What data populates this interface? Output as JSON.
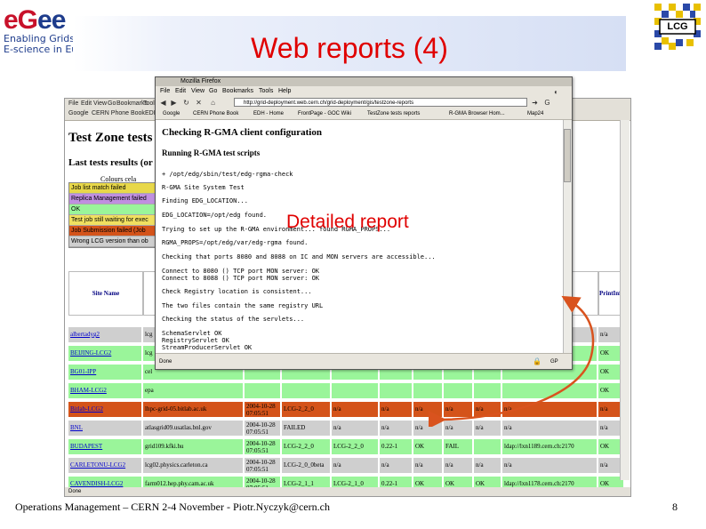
{
  "slide": {
    "title": "Web reports (4)",
    "footer": "Operations Management – CERN 2-4 November - Piotr.Nyczyk@cern.ch",
    "page_number": "8",
    "annotation": "Detailed report",
    "logos": {
      "egee_word_a": "eG",
      "egee_word_b": "ee",
      "egee_line1": "Enabling Grids f",
      "egee_line2": "E-science in Euro",
      "lcg": "LCG"
    },
    "colors": {
      "title": "#e00000",
      "green_row": "#9af59a",
      "grey_row": "#cfcfcf",
      "failed_row": "#d4531a",
      "arrow": "#d9531e"
    }
  },
  "moz": {
    "window_title": "Mozilla Firefox",
    "menu": [
      "File",
      "Edit",
      "View",
      "Go",
      "Bookmarks",
      "Tools",
      "Help"
    ],
    "url": "http://grid-deployment.web.cern.ch/grid-deployment/gis/testzone-reports",
    "bookmarks": [
      "Google",
      "CERN Phone Book",
      "EDH - Home",
      "FrontPage - GOC Wiki",
      "TestZone tests reports",
      "R-GMA Browser Hom...",
      "Map24"
    ],
    "status": "Done",
    "status_right": "GP",
    "log": {
      "heading1": "Checking R-GMA client configuration",
      "heading2": "Running R-GMA test scripts",
      "lines": [
        "+ /opt/edg/sbin/test/edg-rgma-check",
        "R-GMA Site System Test",
        "Finding EDG_LOCATION...",
        "EDG_LOCATION=/opt/edg found.",
        "Trying to set up the R-GMA environment... found RGMA_PROPS...",
        "RGMA_PROPS=/opt/edg/var/edg-rgma found.",
        "Checking that ports 8080 and 8088 on IC and MON servers are accessible...",
        "Connect to 8080 () TCP port MON server: OK",
        "Connect to 8088 () TCP port MON server: OK",
        "Check Registry location is consistent...",
        "The two files contain the same registry URL",
        "Checking the status of the servlets...",
        "SchemaServlet OK",
        "RegistryServlet OK",
        "StreamProducerServlet OK"
      ]
    }
  },
  "bg": {
    "page_title": "Test Zone tests",
    "subtitle": "Last tests results (or",
    "colours_label": "Colours cela",
    "status": "Done",
    "toolbar_items": [
      "File",
      "Edit",
      "View",
      "Go",
      "Bookmarks",
      "Tools"
    ],
    "bookmark_items": [
      "Google",
      "CERN Phone Book",
      "EDI"
    ],
    "legend": [
      {
        "label": "Job list match failed",
        "color": "#e8d84a"
      },
      {
        "label": "Replica Management failed",
        "color": "#c08fe0"
      },
      {
        "label": "OK",
        "color": "#9af59a"
      },
      {
        "label": "Test job still waiting for exec",
        "color": "#f0e060"
      },
      {
        "label": "Job Submission failed (Job",
        "color": "#d4531a"
      },
      {
        "label": "Wrong LCG version than ob",
        "color": "#cfcfcf"
      }
    ],
    "header": {
      "site": "Site Name",
      "print": "PrintInfo"
    },
    "rows": [
      {
        "site": "albertadyg2",
        "ce": "lcg",
        "date": "",
        "ver": "",
        "c5": "",
        "c6": "",
        "c7": "",
        "c8": "",
        "c9": "",
        "c10": "",
        "last": "n/a",
        "color": "#cfcfcf"
      },
      {
        "site": "BEIJING-LCG2",
        "ce": "lcg",
        "date": "",
        "ver": "",
        "c5": "",
        "c6": "",
        "c7": "",
        "c8": "",
        "c9": "",
        "c10": "",
        "last": "OK",
        "color": "#9af59a"
      },
      {
        "site": "BG01-IPP",
        "ce": "cel",
        "date": "",
        "ver": "",
        "c5": "",
        "c6": "",
        "c7": "",
        "c8": "",
        "c9": "",
        "c10": "",
        "last": "OK",
        "color": "#9af59a"
      },
      {
        "site": "BHAM-LCG2",
        "ce": "epa",
        "date": "",
        "ver": "",
        "c5": "",
        "c6": "",
        "c7": "",
        "c8": "",
        "c9": "",
        "c10": "",
        "last": "OK",
        "color": "#9af59a"
      },
      {
        "site": "Bitlab-LCG2",
        "ce": "lhpc-grid-05.bitlab.ac.uk",
        "date": "2004-10-28 07:05:51",
        "ver": "LCG-2_2_0",
        "c5": "n/a",
        "c6": "n/a",
        "c7": "n/a",
        "c8": "n/a",
        "c9": "n/a",
        "c10": "n/a",
        "last": "n/a",
        "color": "#d4531a"
      },
      {
        "site": "BNL",
        "ce": "atlasgrid09.usatlas.bnl.gov",
        "date": "2004-10-28 07:05:51",
        "ver": "FAILED",
        "c5": "n/a",
        "c6": "n/a",
        "c7": "n/a",
        "c8": "n/a",
        "c9": "n/a",
        "c10": "n/a",
        "last": "n/a",
        "color": "#cfcfcf"
      },
      {
        "site": "BUDAPEST",
        "ce": "grid109.kfki.hu",
        "date": "2004-10-28 07:05:51",
        "ver": "LCG-2_2_0",
        "c5": "LCG-2_2_0",
        "c6": "0.22-1",
        "c7": "OK",
        "c8": "FAIL",
        "c9": "",
        "c10": "ldap://lxn1189.cern.ch:2170",
        "last": "OK",
        "color": "#9af59a"
      },
      {
        "site": "CARLETONU-LCG2",
        "ce": "lcg02.physics.carleton.ca",
        "date": "2004-10-28 07:05:51",
        "ver": "LCG-2_0_0beta",
        "c5": "n/a",
        "c6": "n/a",
        "c7": "n/a",
        "c8": "n/a",
        "c9": "n/a",
        "c10": "n/a",
        "last": "n/a",
        "color": "#cfcfcf"
      },
      {
        "site": "CAVENDISH-LCG2",
        "ce": "farm012.hep.phy.cam.ac.uk",
        "date": "2004-10-28 07:05:51",
        "ver": "LCG-2_1_1",
        "c5": "LCG-2_1_0",
        "c6": "0.22-1",
        "c7": "OK",
        "c8": "OK",
        "c9": "OK",
        "c10": "ldap://lxn1178.cern.ch:2170",
        "last": "OK",
        "color": "#9af59a"
      },
      {
        "site": "CCIN2P3-LCG2",
        "ce": "cclcgceli01.in2p3.fr",
        "date": "2004-10-28 11:15:57",
        "ver": "LCG-2_2_0",
        "c5": "LCG-2_2_0",
        "c6": "0.22-1",
        "c7": "OK",
        "c8": "OK",
        "c9": "OK",
        "c10": "ldap://lxn1178.cern.ch:2170",
        "last": "OK",
        "color": "#9af59a"
      }
    ]
  }
}
